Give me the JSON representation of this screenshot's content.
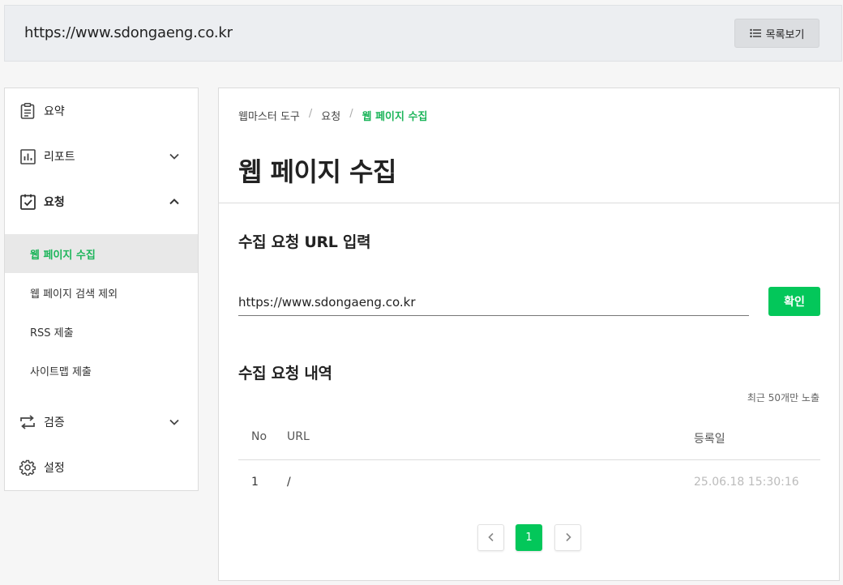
{
  "header": {
    "site_url": "https://www.sdongaeng.co.kr",
    "list_button_label": "목록보기"
  },
  "sidebar": {
    "items": [
      {
        "label": "요약",
        "icon": "clipboard-icon"
      },
      {
        "label": "리포트",
        "icon": "bar-chart-icon",
        "expanded": false
      },
      {
        "label": "요청",
        "icon": "checklist-icon",
        "expanded": true
      },
      {
        "label": "검증",
        "icon": "repeat-arrows-icon",
        "expanded": false
      },
      {
        "label": "설정",
        "icon": "gear-icon"
      }
    ],
    "sub_items": [
      {
        "label": "웹 페이지 수집",
        "active": true
      },
      {
        "label": "웹 페이지 검색 제외",
        "active": false
      },
      {
        "label": "RSS 제출",
        "active": false
      },
      {
        "label": "사이트맵 제출",
        "active": false
      }
    ]
  },
  "breadcrumb": [
    "웹마스터 도구",
    "요청",
    "웹 페이지 수집"
  ],
  "breadcrumb_separator": "/",
  "page_title": "웹 페이지 수집",
  "request_form": {
    "title": "수집 요청 URL 입력",
    "url_value": "https://www.sdongaeng.co.kr",
    "confirm_label": "확인"
  },
  "history": {
    "title": "수집 요청 내역",
    "note": "최근 50개만 노출",
    "columns": [
      "No",
      "URL",
      "등록일"
    ],
    "rows": [
      {
        "no": "1",
        "url": "/",
        "date": "25.06.18 15:30:16"
      }
    ]
  },
  "pagination": {
    "current_page": "1"
  },
  "colors": {
    "accent": "#03c75a",
    "active_text": "#1cb55a"
  }
}
